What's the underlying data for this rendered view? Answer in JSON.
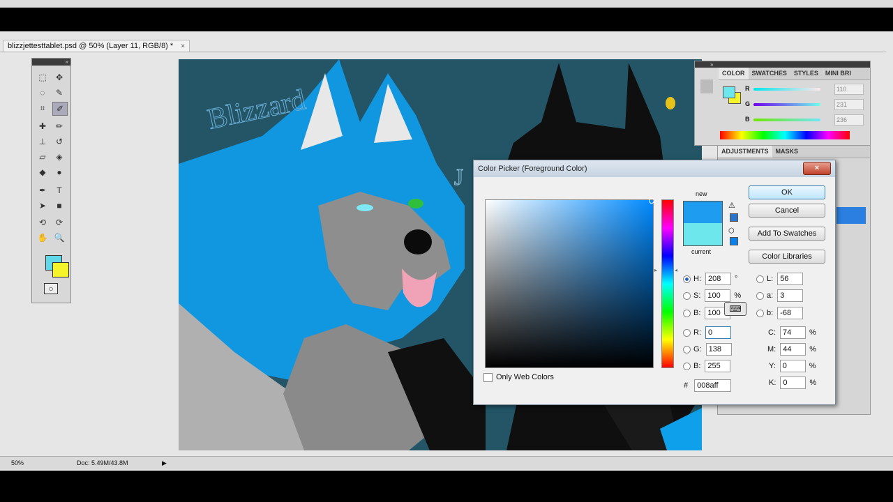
{
  "document": {
    "tab_title": "blizzjettesttablet.psd @ 50% (Layer 11, RGB/8) *",
    "close": "×"
  },
  "canvas": {
    "text_blizzard": "Blizzard",
    "text_j": "J"
  },
  "color_panel": {
    "tabs": [
      "COLOR",
      "SWATCHES",
      "STYLES",
      "MINI BRI"
    ],
    "channels": [
      {
        "label": "R",
        "value": "110"
      },
      {
        "label": "G",
        "value": "231"
      },
      {
        "label": "B",
        "value": "236"
      }
    ],
    "foreground": "#6ee7ec",
    "background": "#f5f32a"
  },
  "adjustments_panel": {
    "tabs": [
      "ADJUSTMENTS",
      "MASKS"
    ]
  },
  "status": {
    "zoom": "50%",
    "doc_info": "Doc: 5.49M/43.8M"
  },
  "color_picker": {
    "title": "Color Picker (Foreground Color)",
    "close": "×",
    "new_label": "new",
    "current_label": "current",
    "new_color": "#1d9cf0",
    "current_color": "#6ee7ec",
    "buttons": {
      "ok": "OK",
      "cancel": "Cancel",
      "add_swatches": "Add To Swatches",
      "color_libraries": "Color Libraries"
    },
    "hsb": [
      {
        "label": "H:",
        "value": "208",
        "unit": "°"
      },
      {
        "label": "S:",
        "value": "100",
        "unit": "%"
      },
      {
        "label": "B:",
        "value": "100",
        "unit": ""
      }
    ],
    "rgb": [
      {
        "label": "R:",
        "value": "0"
      },
      {
        "label": "G:",
        "value": "138"
      },
      {
        "label": "B:",
        "value": "255"
      }
    ],
    "lab": [
      {
        "label": "L:",
        "value": "56"
      },
      {
        "label": "a:",
        "value": "3"
      },
      {
        "label": "b:",
        "value": "-68"
      }
    ],
    "cmyk": [
      {
        "label": "C:",
        "value": "74",
        "unit": "%"
      },
      {
        "label": "M:",
        "value": "44",
        "unit": "%"
      },
      {
        "label": "Y:",
        "value": "0",
        "unit": "%"
      },
      {
        "label": "K:",
        "value": "0",
        "unit": "%"
      }
    ],
    "hex_label": "#",
    "hex": "008aff",
    "web_only_label": "Only Web Colors"
  }
}
